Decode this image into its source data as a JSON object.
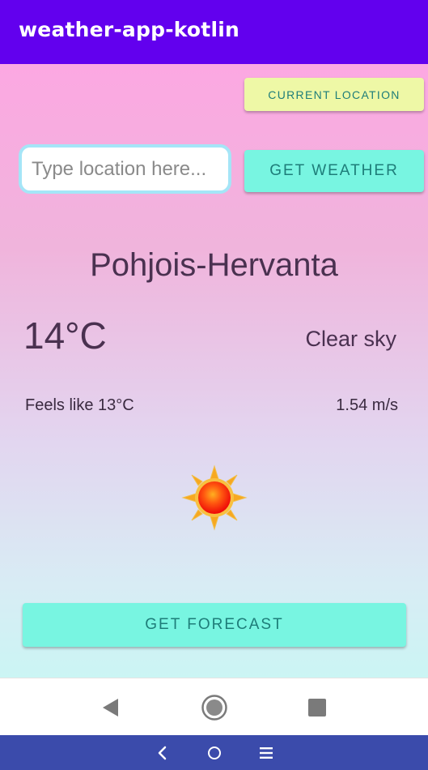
{
  "app": {
    "title": "weather-app-kotlin"
  },
  "actions": {
    "current_location_label": "CURRENT LOCATION",
    "get_weather_label": "GET WEATHER",
    "get_forecast_label": "GET FORECAST"
  },
  "search": {
    "placeholder": "Type location here...",
    "value": ""
  },
  "weather": {
    "city": "Pohjois-Hervanta",
    "temperature": "14°C",
    "description": "Clear sky",
    "feels_like": "Feels like 13°C",
    "wind": "1.54 m/s",
    "icon": "sun-icon"
  },
  "navigation": {
    "back_icon": "back-triangle-icon",
    "home_icon": "home-circle-icon",
    "recents_icon": "recents-square-icon"
  },
  "system_bar": {
    "back_icon": "chevron-left-icon",
    "home_icon": "circle-icon",
    "menu_icon": "menu-icon"
  },
  "colors": {
    "app_bar": "#6200ee",
    "accent_button": "#78f5e1",
    "location_button": "#eef8a6",
    "text_primary": "#4a3150",
    "system_bar": "#3b4bab"
  }
}
